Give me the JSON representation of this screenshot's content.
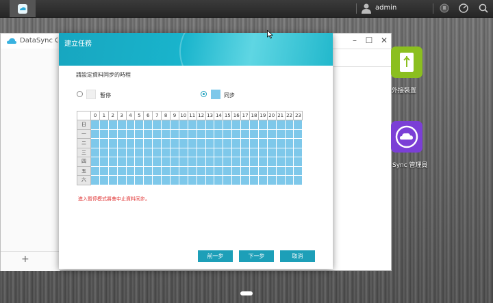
{
  "taskbar": {
    "username": "admin"
  },
  "datasync_window": {
    "title": "DataSync Center",
    "add_label": "+"
  },
  "desktop_icons": [
    {
      "label": "外接裝置",
      "color": "#8bbf1f"
    },
    {
      "label": "Sync 管理員",
      "color": "#7b3fd6"
    }
  ],
  "dialog": {
    "title": "建立任務",
    "prompt": "請設定資料同步的時程",
    "options": [
      {
        "label": "暫停",
        "selected": false,
        "swatch_color": "#f0f0f0"
      },
      {
        "label": "同步",
        "selected": true,
        "swatch_color": "#7ec8ea"
      }
    ],
    "schedule": {
      "hours": [
        "0",
        "1",
        "2",
        "3",
        "4",
        "5",
        "6",
        "7",
        "8",
        "9",
        "10",
        "11",
        "12",
        "13",
        "14",
        "15",
        "16",
        "17",
        "18",
        "19",
        "20",
        "21",
        "22",
        "23"
      ],
      "days": [
        "日",
        "一",
        "二",
        "三",
        "四",
        "五",
        "六"
      ],
      "sync_color": "#7ec8ea"
    },
    "warning": "進入暫停模式將會中止資料同步。",
    "buttons": {
      "prev": "前一步",
      "next": "下一步",
      "cancel": "取消"
    },
    "header_color": "#17a6c0",
    "button_color": "#1d9fb8"
  }
}
